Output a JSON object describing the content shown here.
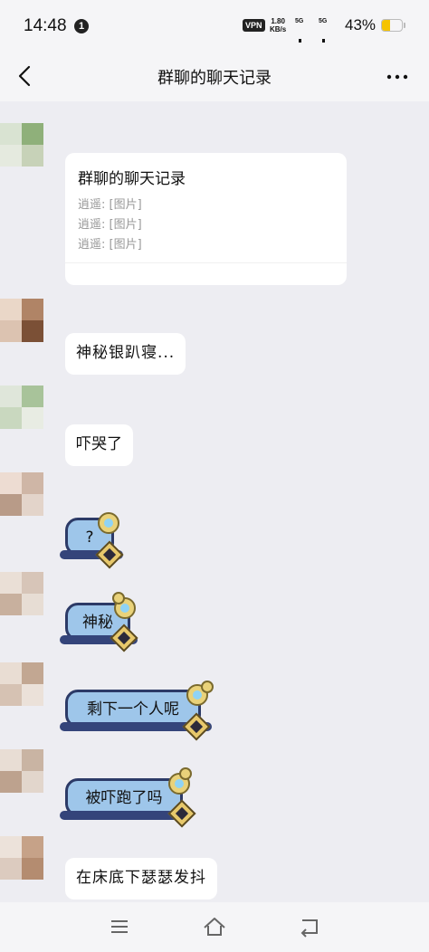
{
  "status_bar": {
    "time": "14:48",
    "notification_count": "1",
    "vpn": "VPN",
    "net_speed_value": "1.80",
    "net_speed_unit": "KB/s",
    "signal_1": "5G",
    "signal_2": "5G",
    "battery": "43%",
    "battery_level": 0.43
  },
  "header": {
    "title": "群聊的聊天记录",
    "back_icon": "chevron-left-icon",
    "more_icon": "more-horizontal-icon"
  },
  "messages": {
    "forward_card": {
      "title": "群聊的聊天记录",
      "rows": [
        "逍遥: [图片]",
        "逍遥: [图片]",
        "逍遥: [图片]"
      ]
    },
    "m1": "神秘银趴寝...",
    "m2": "吓哭了",
    "s1": "?",
    "s2": "神秘",
    "s3": "剩下一个人呢",
    "s4": "被吓跑了吗",
    "m3": "在床底下瑟瑟发抖"
  },
  "nav": {
    "menu_icon": "menu-icon",
    "home_icon": "home-icon",
    "back_icon": "back-icon"
  },
  "colors": {
    "background": "#ededf2",
    "bubble": "#ffffff",
    "sticker_blue": "#9ec6ea",
    "sticker_navy": "#34447a",
    "battery": "#f5c300"
  }
}
